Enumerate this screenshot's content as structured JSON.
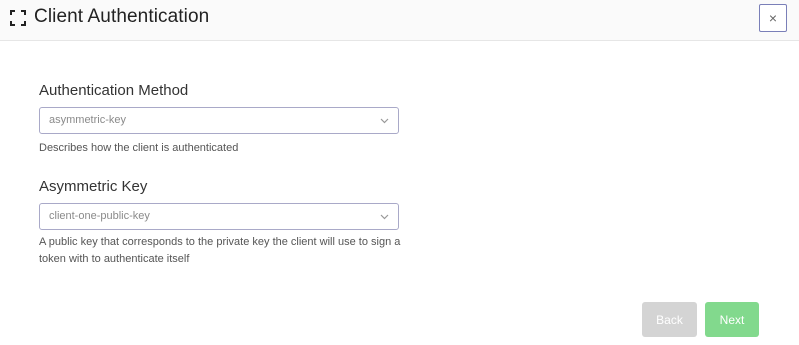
{
  "header": {
    "title": "Client Authentication",
    "close_label": "×"
  },
  "fields": {
    "auth_method": {
      "label": "Authentication Method",
      "value": "asymmetric-key",
      "help": "Describes how the client is authenticated"
    },
    "asymmetric_key": {
      "label": "Asymmetric Key",
      "value": "client-one-public-key",
      "help": "A public key that corresponds to the private key the client will use to sign a token with to authenticate itself"
    }
  },
  "buttons": {
    "back_label": "Back",
    "next_label": "Next"
  },
  "colors": {
    "next_button": "#82d98d",
    "back_button": "#d4d4d4",
    "select_border": "#a9a9c8"
  },
  "icons": {
    "header_left": "expand-icon",
    "close": "close-icon",
    "dropdown": "chevron-down-icon"
  }
}
